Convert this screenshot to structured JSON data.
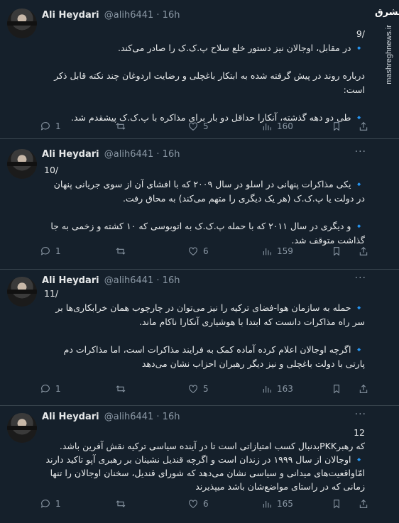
{
  "watermark": {
    "site": "mashreghnews.ir",
    "logo": "مشرق"
  },
  "tweets": [
    {
      "author": "Ali Heydari",
      "handle": "@alih6441 · 16h",
      "index": "9/",
      "lines": [
        "🔹 در مقابل، اوجالان نیز دستور خلع سلاح پ.ک.ک را صادر می‌کند.",
        "",
        "درباره روند در پیش گرفته شده به ابتکار باغچلی و رضایت اردوغان چند نکته قابل ذکر است:",
        "",
        "🔹 طی دو دهه گذشته، آنکارا حداقل دو بار برای مذاکره با پ.ک.ک پیشقدم شد."
      ],
      "replies": "1",
      "retweets": "",
      "likes": "5",
      "views": "160"
    },
    {
      "author": "Ali Heydari",
      "handle": "@alih6441 · 16h",
      "index": "10/",
      "lines": [
        "🔹 یکی مذاکرات پنهانی در اسلو در سال ۲۰۰۹ که با افشای آن از سوی جریانی پنهان در دولت یا پ.ک.ک (هر یک دیگری را متهم می‌کند) به محاق رفت.",
        "",
        "🔹 و دیگری در سال ۲۰۱۱ که با حمله پ.ک.ک به اتوبوسی که ۱۰ کشته و زخمی به جا گذاشت متوقف شد."
      ],
      "replies": "1",
      "retweets": "",
      "likes": "6",
      "views": "159"
    },
    {
      "author": "Ali Heydari",
      "handle": "@alih6441 · 16h",
      "index": "11/",
      "lines": [
        "🔹 حمله به سازمان هوا-فضای ترکیه را نیز می‌توان در چارچوب همان خرابکاری‌ها بر سر راه مذاکرات دانست که ابتدا با هوشیاری آنکارا ناکام ماند.",
        "",
        "🔹 اگرچه اوجالان اعلام کرده آماده کمک به فرایند مذاکرات است، اما مذاکرات دم پارتی با دولت باغچلی و نیز دیگر رهبران احزاب نشان می‌دهد"
      ],
      "replies": "1",
      "retweets": "",
      "likes": "5",
      "views": "163"
    },
    {
      "author": "Ali Heydari",
      "handle": "@alih6441 · 16h",
      "index": "12",
      "lines": [
        "که رهبرPKKبدنبال کسب امتیازاتی است تا در آینده سیاسی ترکیه نقش آفرین باشد.",
        "🔹 اوجالان از سال ۱۹۹۹ در زندان است و اگرچه قندیل نشینان بر رهبری آپو تاکید دارند امّاواقعیت‌های میدانی و سیاسی نشان می‌دهد که شورای قندیل، سخنان اوجالان را تنها زمانی که در راستای مواضع‌شان باشد میپذیرند"
      ],
      "replies": "1",
      "retweets": "",
      "likes": "6",
      "views": "165"
    }
  ]
}
